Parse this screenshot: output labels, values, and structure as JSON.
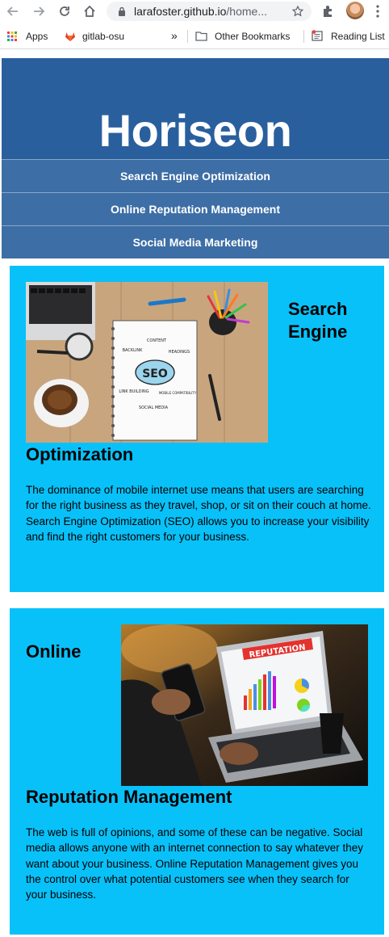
{
  "browser": {
    "url_host": "larafoster.github.io",
    "url_path": "/home...",
    "bookmarks": [
      {
        "label": "Apps"
      },
      {
        "label": "gitlab-osu"
      },
      {
        "label": "»"
      },
      {
        "label": "Other Bookmarks"
      },
      {
        "label": "Reading List"
      }
    ]
  },
  "header": {
    "logo": "Horiseon",
    "nav": [
      {
        "label": "Search Engine Optimization"
      },
      {
        "label": "Online Reputation Management"
      },
      {
        "label": "Social Media Marketing"
      }
    ]
  },
  "cards": [
    {
      "title_line1": "Search",
      "title_line2": "Engine",
      "title_line3": "Optimization",
      "image_words": {
        "seo": "SEO",
        "content": "CONTENT",
        "backlink": "BACKLINK",
        "headings": "HEADINGS",
        "link_building": "LINK BUILDING",
        "mobile": "MOBILE COMPATIBILITY",
        "social": "SOCIAL MEDIA"
      },
      "text": "The dominance of mobile internet use means that users are searching for the right business as they travel, shop, or sit on their couch at home. Search Engine Optimization (SEO) allows you to increase your visibility and find the right customers for your business."
    },
    {
      "title_line1": "Online",
      "title_line2": "Reputation Management",
      "image_words": {
        "reputation": "REPUTATION"
      },
      "text": "The web is full of opinions, and some of these can be negative. Social media allows anyone with an internet connection to say whatever they want about your business. Online Reputation Management gives you the control over what potential customers see when they search for your business."
    }
  ],
  "colors": {
    "header_bg": "#2a5f9e",
    "nav_bg": "#3d6ea6",
    "card_bg": "#09c1f9"
  }
}
